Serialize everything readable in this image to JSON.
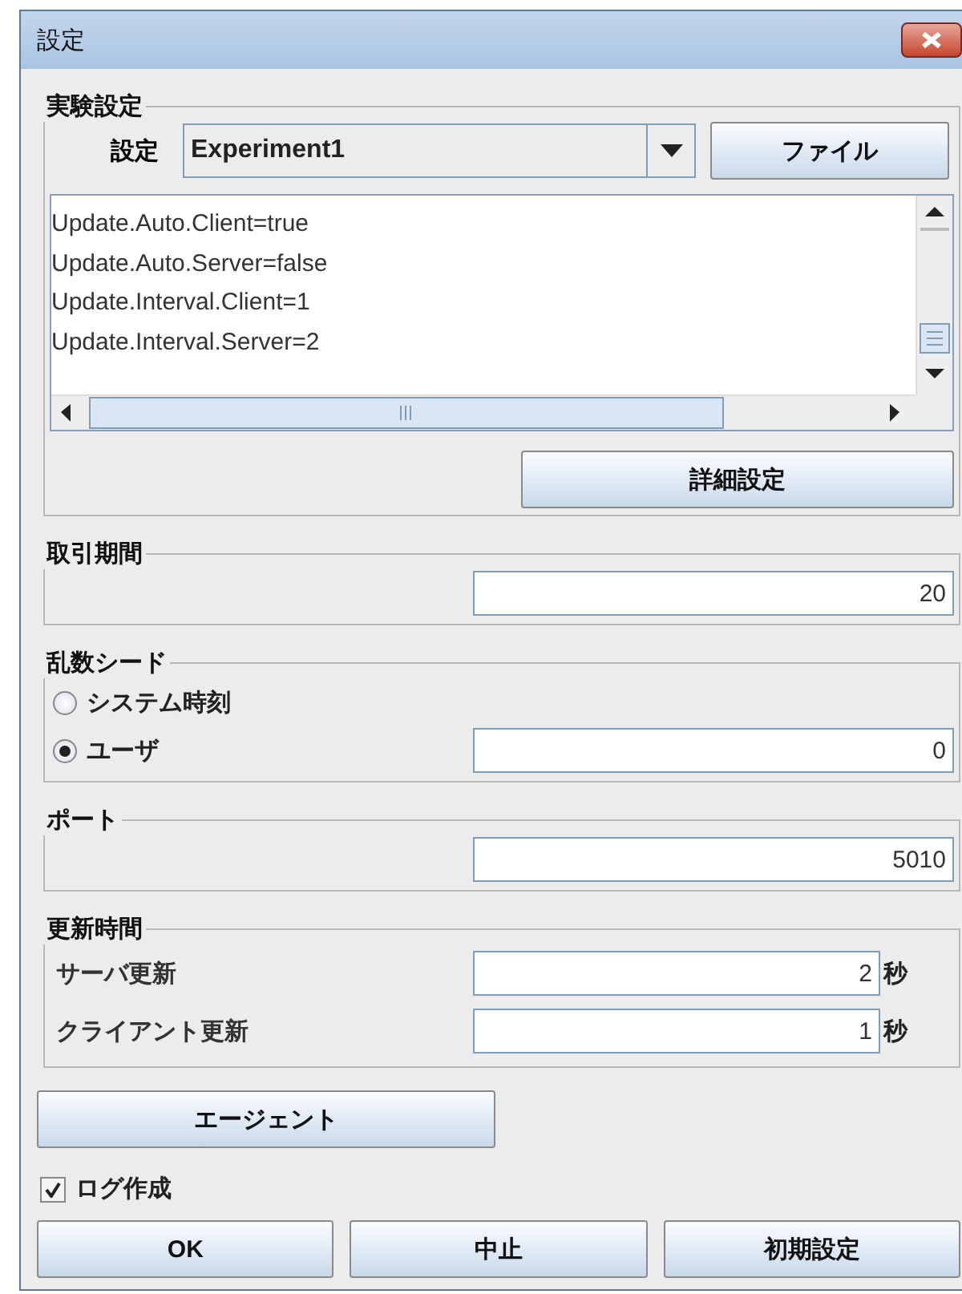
{
  "window": {
    "title": "設定"
  },
  "experiment": {
    "title": "実験設定",
    "setting_label": "設定",
    "setting_value": "Experiment1",
    "file_button": "ファイル",
    "properties": [
      "Update.Auto.Client=true",
      "Update.Auto.Server=false",
      "Update.Interval.Client=1",
      "Update.Interval.Server=2"
    ],
    "details_button": "詳細設定"
  },
  "trading_period": {
    "title": "取引期間",
    "value": "20"
  },
  "random_seed": {
    "title": "乱数シード",
    "options": [
      {
        "label": "システム時刻",
        "selected": false
      },
      {
        "label": "ユーザ",
        "selected": true
      }
    ],
    "value": "0"
  },
  "port": {
    "title": "ポート",
    "value": "5010"
  },
  "update_time": {
    "title": "更新時間",
    "rows": [
      {
        "label": "サーバ更新",
        "value": "2",
        "unit": "秒"
      },
      {
        "label": "クライアント更新",
        "value": "1",
        "unit": "秒"
      }
    ]
  },
  "agent_button": "エージェント",
  "log": {
    "label": "ログ作成",
    "checked": true
  },
  "buttons": [
    "OK",
    "中止",
    "初期設定"
  ]
}
